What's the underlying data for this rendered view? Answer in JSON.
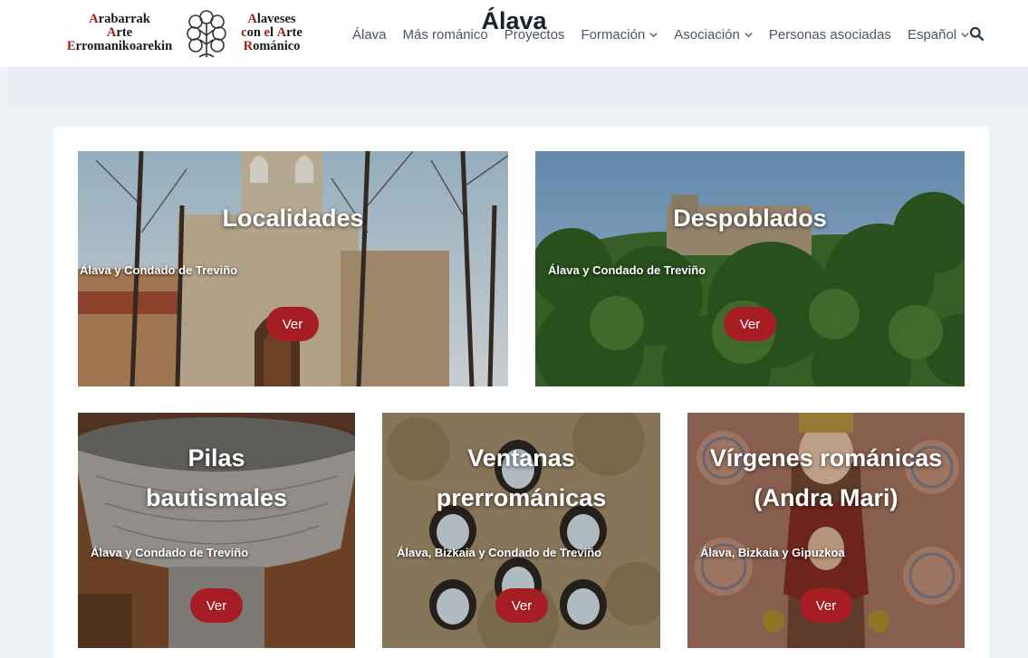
{
  "logo": {
    "left": [
      "Arabarrak",
      "Arte",
      "Erromanikoarekin"
    ],
    "right": [
      "Alaveses",
      "con el Arte",
      "Románico"
    ]
  },
  "nav": {
    "items": [
      {
        "label": "Álava",
        "dropdown": false
      },
      {
        "label": "Más románico",
        "dropdown": false
      },
      {
        "label": "Proyectos",
        "dropdown": false
      },
      {
        "label": "Formación",
        "dropdown": true
      },
      {
        "label": "Asociación",
        "dropdown": true
      },
      {
        "label": "Personas asociadas",
        "dropdown": false
      },
      {
        "label": "Español",
        "dropdown": true
      }
    ],
    "search_icon": "search-icon"
  },
  "page": {
    "title": "Álava"
  },
  "cards": [
    {
      "title": "Localidades",
      "subtitle": "Álava y Condado de Treviño",
      "button": "Ver"
    },
    {
      "title": "Despoblados",
      "subtitle": "Álava y Condado de Treviño",
      "button": "Ver"
    },
    {
      "title_lines": [
        "Pilas",
        "bautismales"
      ],
      "subtitle": "Álava y Condado de Treviño",
      "button": "Ver"
    },
    {
      "title_lines": [
        "Ventanas",
        "prerrománicas"
      ],
      "subtitle": "Álava, Bizkaia y Condado de Treviño",
      "button": "Ver"
    },
    {
      "title_lines": [
        "Vírgenes románicas",
        "(Andra Mari)"
      ],
      "subtitle": "Álava, Bizkaia y Gipuzkoa",
      "button": "Ver"
    }
  ],
  "colors": {
    "accent": "#a61d24",
    "logo_red": "#9b1c1c",
    "page_bg": "#edf2f7"
  }
}
